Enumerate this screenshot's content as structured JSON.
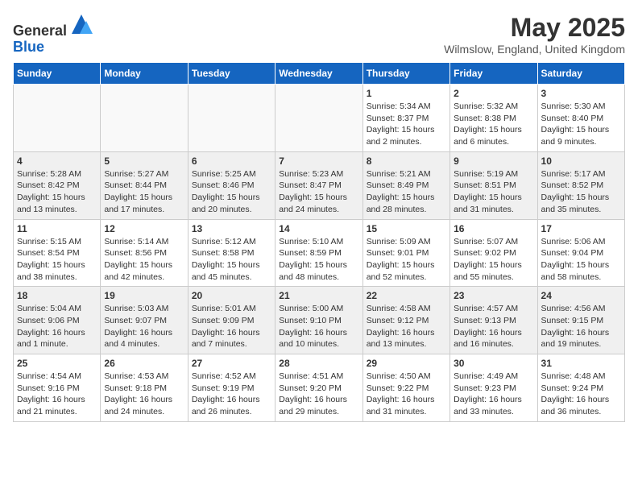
{
  "header": {
    "logo_line1": "General",
    "logo_line2": "Blue",
    "month_title": "May 2025",
    "location": "Wilmslow, England, United Kingdom"
  },
  "weekdays": [
    "Sunday",
    "Monday",
    "Tuesday",
    "Wednesday",
    "Thursday",
    "Friday",
    "Saturday"
  ],
  "weeks": [
    [
      {
        "day": "",
        "info": ""
      },
      {
        "day": "",
        "info": ""
      },
      {
        "day": "",
        "info": ""
      },
      {
        "day": "",
        "info": ""
      },
      {
        "day": "1",
        "info": "Sunrise: 5:34 AM\nSunset: 8:37 PM\nDaylight: 15 hours\nand 2 minutes."
      },
      {
        "day": "2",
        "info": "Sunrise: 5:32 AM\nSunset: 8:38 PM\nDaylight: 15 hours\nand 6 minutes."
      },
      {
        "day": "3",
        "info": "Sunrise: 5:30 AM\nSunset: 8:40 PM\nDaylight: 15 hours\nand 9 minutes."
      }
    ],
    [
      {
        "day": "4",
        "info": "Sunrise: 5:28 AM\nSunset: 8:42 PM\nDaylight: 15 hours\nand 13 minutes."
      },
      {
        "day": "5",
        "info": "Sunrise: 5:27 AM\nSunset: 8:44 PM\nDaylight: 15 hours\nand 17 minutes."
      },
      {
        "day": "6",
        "info": "Sunrise: 5:25 AM\nSunset: 8:46 PM\nDaylight: 15 hours\nand 20 minutes."
      },
      {
        "day": "7",
        "info": "Sunrise: 5:23 AM\nSunset: 8:47 PM\nDaylight: 15 hours\nand 24 minutes."
      },
      {
        "day": "8",
        "info": "Sunrise: 5:21 AM\nSunset: 8:49 PM\nDaylight: 15 hours\nand 28 minutes."
      },
      {
        "day": "9",
        "info": "Sunrise: 5:19 AM\nSunset: 8:51 PM\nDaylight: 15 hours\nand 31 minutes."
      },
      {
        "day": "10",
        "info": "Sunrise: 5:17 AM\nSunset: 8:52 PM\nDaylight: 15 hours\nand 35 minutes."
      }
    ],
    [
      {
        "day": "11",
        "info": "Sunrise: 5:15 AM\nSunset: 8:54 PM\nDaylight: 15 hours\nand 38 minutes."
      },
      {
        "day": "12",
        "info": "Sunrise: 5:14 AM\nSunset: 8:56 PM\nDaylight: 15 hours\nand 42 minutes."
      },
      {
        "day": "13",
        "info": "Sunrise: 5:12 AM\nSunset: 8:58 PM\nDaylight: 15 hours\nand 45 minutes."
      },
      {
        "day": "14",
        "info": "Sunrise: 5:10 AM\nSunset: 8:59 PM\nDaylight: 15 hours\nand 48 minutes."
      },
      {
        "day": "15",
        "info": "Sunrise: 5:09 AM\nSunset: 9:01 PM\nDaylight: 15 hours\nand 52 minutes."
      },
      {
        "day": "16",
        "info": "Sunrise: 5:07 AM\nSunset: 9:02 PM\nDaylight: 15 hours\nand 55 minutes."
      },
      {
        "day": "17",
        "info": "Sunrise: 5:06 AM\nSunset: 9:04 PM\nDaylight: 15 hours\nand 58 minutes."
      }
    ],
    [
      {
        "day": "18",
        "info": "Sunrise: 5:04 AM\nSunset: 9:06 PM\nDaylight: 16 hours\nand 1 minute."
      },
      {
        "day": "19",
        "info": "Sunrise: 5:03 AM\nSunset: 9:07 PM\nDaylight: 16 hours\nand 4 minutes."
      },
      {
        "day": "20",
        "info": "Sunrise: 5:01 AM\nSunset: 9:09 PM\nDaylight: 16 hours\nand 7 minutes."
      },
      {
        "day": "21",
        "info": "Sunrise: 5:00 AM\nSunset: 9:10 PM\nDaylight: 16 hours\nand 10 minutes."
      },
      {
        "day": "22",
        "info": "Sunrise: 4:58 AM\nSunset: 9:12 PM\nDaylight: 16 hours\nand 13 minutes."
      },
      {
        "day": "23",
        "info": "Sunrise: 4:57 AM\nSunset: 9:13 PM\nDaylight: 16 hours\nand 16 minutes."
      },
      {
        "day": "24",
        "info": "Sunrise: 4:56 AM\nSunset: 9:15 PM\nDaylight: 16 hours\nand 19 minutes."
      }
    ],
    [
      {
        "day": "25",
        "info": "Sunrise: 4:54 AM\nSunset: 9:16 PM\nDaylight: 16 hours\nand 21 minutes."
      },
      {
        "day": "26",
        "info": "Sunrise: 4:53 AM\nSunset: 9:18 PM\nDaylight: 16 hours\nand 24 minutes."
      },
      {
        "day": "27",
        "info": "Sunrise: 4:52 AM\nSunset: 9:19 PM\nDaylight: 16 hours\nand 26 minutes."
      },
      {
        "day": "28",
        "info": "Sunrise: 4:51 AM\nSunset: 9:20 PM\nDaylight: 16 hours\nand 29 minutes."
      },
      {
        "day": "29",
        "info": "Sunrise: 4:50 AM\nSunset: 9:22 PM\nDaylight: 16 hours\nand 31 minutes."
      },
      {
        "day": "30",
        "info": "Sunrise: 4:49 AM\nSunset: 9:23 PM\nDaylight: 16 hours\nand 33 minutes."
      },
      {
        "day": "31",
        "info": "Sunrise: 4:48 AM\nSunset: 9:24 PM\nDaylight: 16 hours\nand 36 minutes."
      }
    ]
  ]
}
